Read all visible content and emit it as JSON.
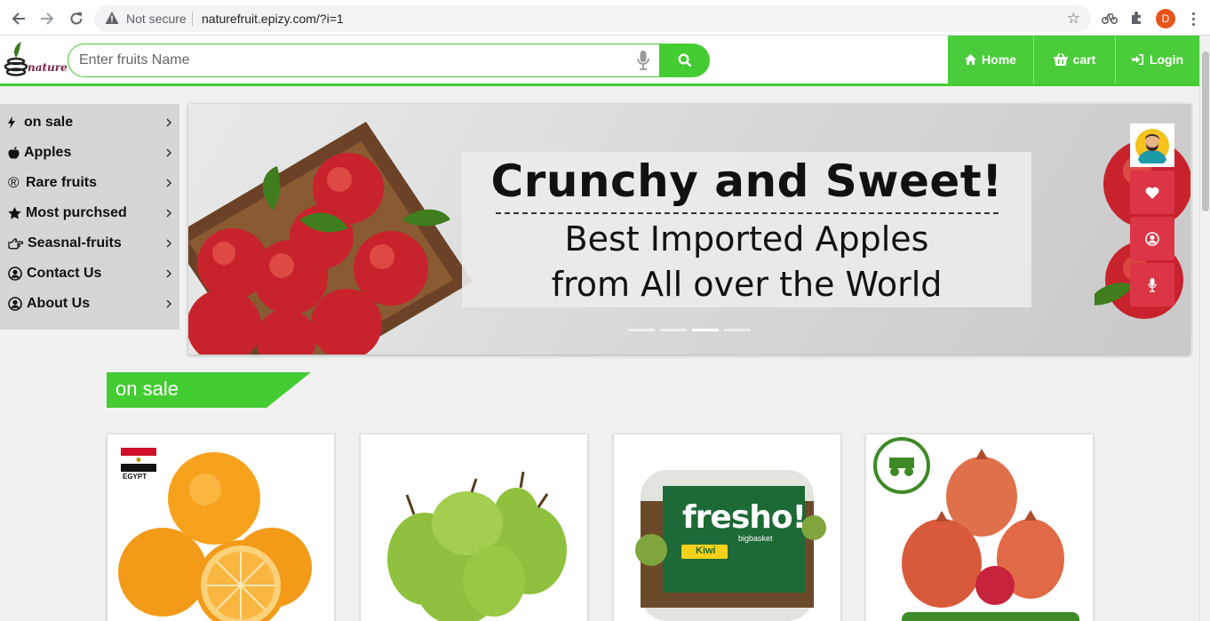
{
  "browser": {
    "security_label": "Not secure",
    "url": "naturefruit.epizy.com/?i=1",
    "profile_initial": "D"
  },
  "header": {
    "logo_text": "nature",
    "search_placeholder": "Enter fruits Name",
    "nav": [
      {
        "label": "Home",
        "icon": "home-icon"
      },
      {
        "label": "cart",
        "icon": "basket-icon"
      },
      {
        "label": "Login",
        "icon": "sign-in-icon"
      }
    ]
  },
  "sidebar": {
    "items": [
      {
        "label": "on sale",
        "icon": "bolt-icon"
      },
      {
        "label": "Apples",
        "icon": "apple-icon"
      },
      {
        "label": "Rare fruits",
        "icon": "registered-icon"
      },
      {
        "label": "Most purchsed",
        "icon": "star-icon"
      },
      {
        "label": "Seasnal-fruits",
        "icon": "hand-point-right-icon"
      },
      {
        "label": "Contact Us",
        "icon": "user-circle-icon"
      },
      {
        "label": "About Us",
        "icon": "user-circle-icon"
      }
    ]
  },
  "banner": {
    "headline": "Crunchy and Sweet!",
    "line1": "Best Imported Apples",
    "line2": "from All over the World",
    "slide_count": 4,
    "active_slide": 3
  },
  "section": {
    "title": "on sale"
  },
  "products": [
    {
      "image": "oranges",
      "flag_label": "EGYPT"
    },
    {
      "image": "pears"
    },
    {
      "image": "kiwi-pack",
      "brand": "fresho!",
      "sub_brand": "bigbasket",
      "label": "Kiwi"
    },
    {
      "image": "pomegranates"
    }
  ],
  "colors": {
    "accent": "#44cc33",
    "float_button": "#dc3545",
    "sidebar_bg": "#d6d6d6"
  }
}
